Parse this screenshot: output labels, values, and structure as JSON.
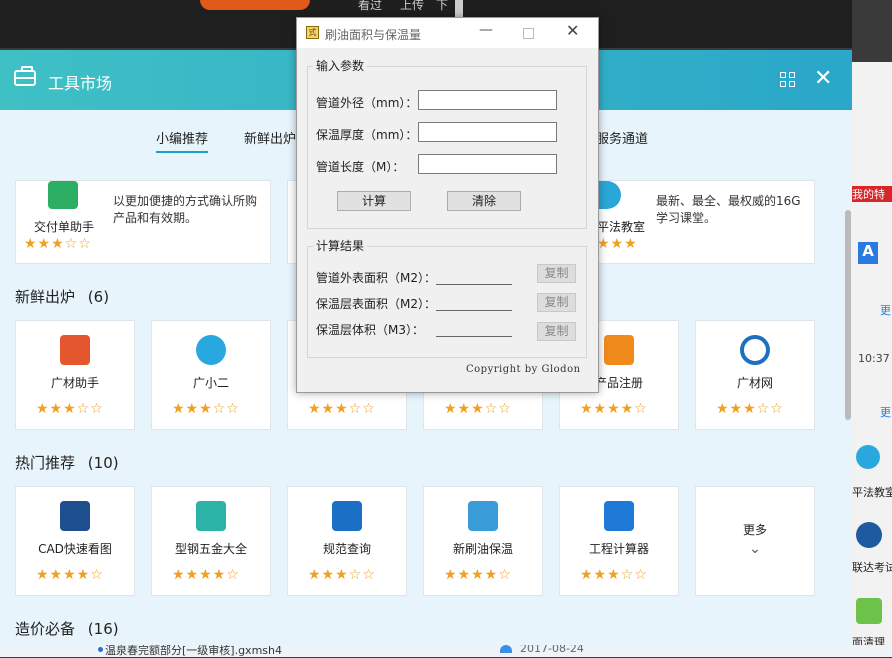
{
  "background": {
    "top_text_1": "看过",
    "top_text_2": "上传",
    "top_text_3": "下",
    "bottom_file": "温泉春完额部分[一级审核].gxmsh4",
    "bottom_date": "2017-08-24",
    "right_texts": [
      "我的特",
      "更",
      "10:37",
      "更",
      "平法教室",
      "联达考试",
      "面清理"
    ]
  },
  "market": {
    "title": "工具市场",
    "tabs": [
      "小编推荐",
      "新鲜出炉",
      "服务通道"
    ],
    "featured": [
      {
        "name": "交付单助手",
        "desc_line1": "以更加便捷的方式确认所购",
        "desc_line2": "产品和有效期。",
        "stars": "★★★☆☆"
      },
      {
        "name": "平法教室",
        "desc_line1": "最新、最全、最权威的16G",
        "desc_line2": "学习课堂。",
        "stars": "★★★"
      }
    ],
    "section_new": {
      "title": "新鲜出炉",
      "count": "(6)"
    },
    "new_items": [
      {
        "name": "广材助手",
        "stars": "★★★☆☆"
      },
      {
        "name": "广小二",
        "stars": "★★★☆☆"
      },
      {
        "name": "",
        "stars": "★★★☆☆"
      },
      {
        "name": "",
        "stars": "★★★☆☆"
      },
      {
        "name": "产品注册",
        "stars": "★★★★☆"
      },
      {
        "name": "广材网",
        "stars": "★★★☆☆"
      }
    ],
    "section_hot": {
      "title": "热门推荐",
      "count": "(10)"
    },
    "hot_items": [
      {
        "name": "CAD快速看图",
        "stars": "★★★★☆"
      },
      {
        "name": "型钢五金大全",
        "stars": "★★★★☆"
      },
      {
        "name": "规范查询",
        "stars": "★★★☆☆"
      },
      {
        "name": "新刷油保温",
        "stars": "★★★★☆"
      },
      {
        "name": "工程计算器",
        "stars": "★★★☆☆"
      }
    ],
    "more_label": "更多",
    "section_cost": {
      "title": "造价必备",
      "count": "(16)"
    }
  },
  "dialog": {
    "title": "刷油面积与保温量",
    "input_group": "输入参数",
    "outer_diameter_label": "管道外径（mm）：",
    "insulation_thickness_label": "保温厚度（mm）：",
    "pipe_length_label": "管道长度（M）：",
    "calc_button": "计算",
    "clear_button": "清除",
    "result_group": "计算结果",
    "outer_area_label": "管道外表面积（M2）：",
    "insulation_area_label": "保温层表面积（M2）：",
    "insulation_volume_label": "保温层体积（M3）：",
    "copy_button": "复制",
    "copyright": "Copyright by Glodon"
  }
}
